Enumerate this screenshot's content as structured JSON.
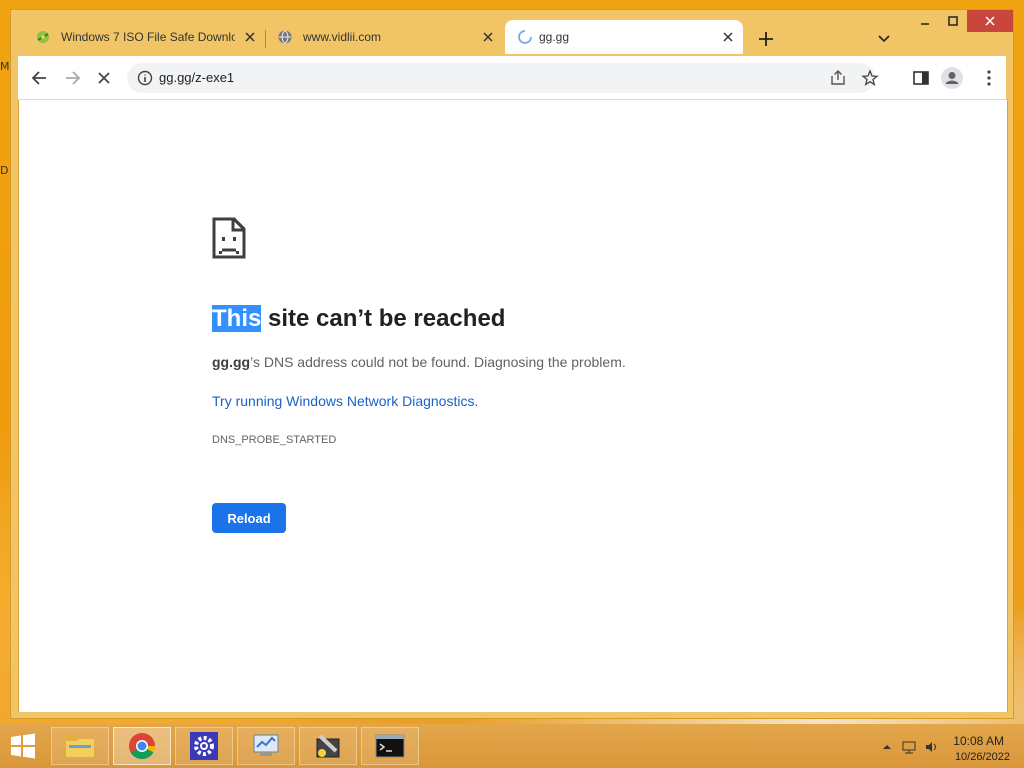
{
  "tabs": [
    {
      "title": "Windows 7 ISO File Safe Downlo",
      "icon": "site-favicon"
    },
    {
      "title": "www.vidlii.com",
      "icon": "globe-icon"
    },
    {
      "title": "gg.gg",
      "icon": "loading-spinner-icon",
      "active": true
    }
  ],
  "toolbar": {
    "url": "gg.gg/z-exe1"
  },
  "error": {
    "title_selected": "This",
    "title_rest": " site can’t be reached",
    "host": "gg.gg",
    "desc_rest": "’s DNS address could not be found. Diagnosing the problem.",
    "link_text": "Try running Windows Network Diagnostics",
    "link_period": ".",
    "code": "DNS_PROBE_STARTED",
    "reload_label": "Reload"
  },
  "desktop": {
    "left_letters": [
      "M",
      "D"
    ]
  },
  "taskbar": {
    "apps": [
      "file-explorer-icon",
      "chrome-icon",
      "settings-icon",
      "network-icon",
      "tool-icon",
      "command-prompt-icon"
    ],
    "time": "10:08 AM",
    "date": "10/26/2022"
  },
  "colors": {
    "accent": "#1a73e8",
    "link": "#1a62c6",
    "selection": "#3390ff",
    "desktop": "#f1a412"
  }
}
